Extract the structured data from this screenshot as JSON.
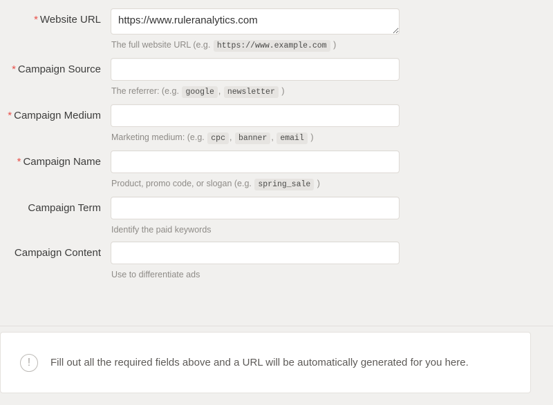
{
  "form": {
    "rows": [
      {
        "label": "Website URL",
        "required": true,
        "star": "*",
        "input_type": "textarea",
        "value": "https://www.ruleranalytics.com",
        "placeholder": "",
        "help_prefix": "The full website URL (e.g.",
        "help_codes": [
          "https://www.example.com"
        ],
        "help_suffix": ")"
      },
      {
        "label": "Campaign Source",
        "required": true,
        "star": "*",
        "input_type": "input",
        "value": "",
        "placeholder": "",
        "help_prefix": "The referrer: (e.g.",
        "help_codes": [
          "google",
          "newsletter"
        ],
        "help_suffix": ")"
      },
      {
        "label": "Campaign Medium",
        "required": true,
        "star": "*",
        "input_type": "input",
        "value": "",
        "placeholder": "",
        "help_prefix": "Marketing medium: (e.g.",
        "help_codes": [
          "cpc",
          "banner",
          "email"
        ],
        "help_suffix": ")"
      },
      {
        "label": "Campaign Name",
        "required": true,
        "star": "*",
        "input_type": "input",
        "value": "",
        "placeholder": "",
        "help_prefix": "Product, promo code, or slogan (e.g.",
        "help_codes": [
          "spring_sale"
        ],
        "help_suffix": ")"
      },
      {
        "label": "Campaign Term",
        "required": false,
        "star": "",
        "input_type": "input",
        "value": "",
        "placeholder": "",
        "help_prefix": "Identify the paid keywords",
        "help_codes": [],
        "help_suffix": ""
      },
      {
        "label": "Campaign Content",
        "required": false,
        "star": "",
        "input_type": "input",
        "value": "",
        "placeholder": "",
        "help_prefix": "Use to differentiate ads",
        "help_codes": [],
        "help_suffix": ""
      }
    ]
  },
  "alert": {
    "icon": "exclamation-circle-icon",
    "icon_glyph": "!",
    "message": "Fill out all the required fields above and a URL will be automatically generated for you here."
  },
  "colors": {
    "page_background": "#f1f0ee",
    "required_star": "#e8504a",
    "input_border": "#dedad5",
    "help_text": "#8e8b87",
    "code_chip_background": "#e6e4e1",
    "card_background": "#ffffff",
    "divider": "#e2dfdb"
  }
}
